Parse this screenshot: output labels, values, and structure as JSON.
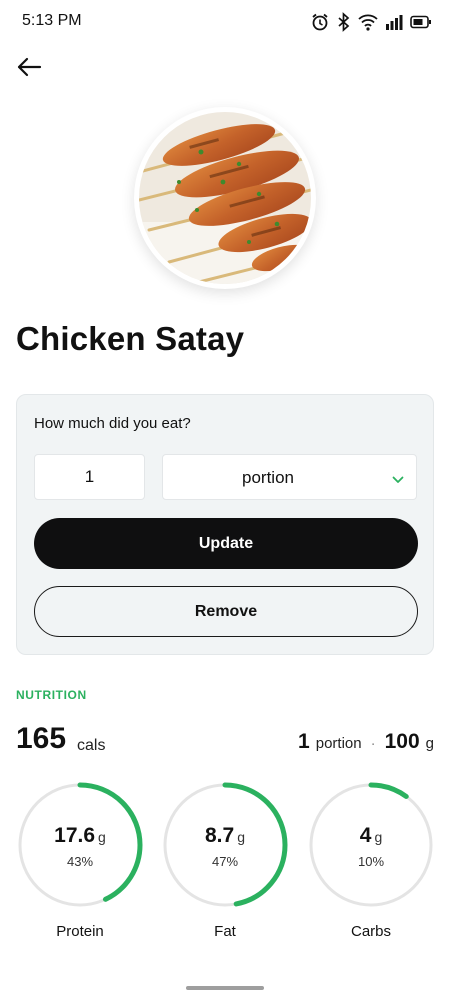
{
  "status_bar": {
    "time": "5:13 PM",
    "icons": [
      "alarm-icon",
      "bluetooth-icon",
      "wifi-icon",
      "signal-icon",
      "battery-icon"
    ]
  },
  "nav": {
    "back_icon": "arrow-left-icon"
  },
  "food": {
    "title": "Chicken Satay"
  },
  "portion": {
    "question": "How much did you eat?",
    "quantity": "1",
    "unit": "portion",
    "update_label": "Update",
    "remove_label": "Remove"
  },
  "nutrition": {
    "heading": "NUTRITION",
    "calories": "165",
    "calories_unit": "cals",
    "serving_count": "1",
    "serving_unit": "portion",
    "separator": "·",
    "weight_value": "100",
    "weight_unit": "g",
    "macros": [
      {
        "name": "Protein",
        "grams": "17.6",
        "unit": "g",
        "percent_label": "43%",
        "percent": 0.43
      },
      {
        "name": "Fat",
        "grams": "8.7",
        "unit": "g",
        "percent_label": "47%",
        "percent": 0.47
      },
      {
        "name": "Carbs",
        "grams": "4",
        "unit": "g",
        "percent_label": "10%",
        "percent": 0.1
      }
    ]
  },
  "colors": {
    "accent_green": "#2bb15f",
    "ring_track": "#e4e4e4",
    "button_dark": "#0f0f10",
    "card_background": "#f1f4f5"
  }
}
